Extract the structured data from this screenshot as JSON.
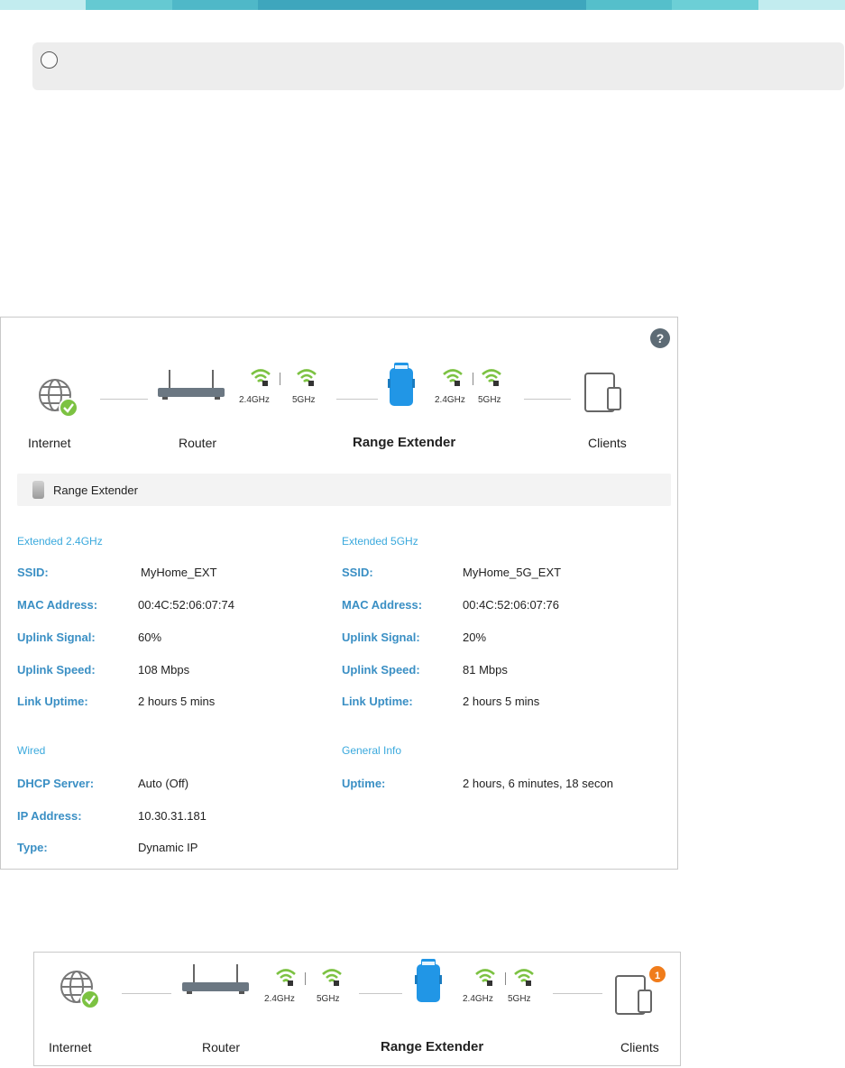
{
  "colors": {
    "accent_blue": "#3aa9dd",
    "label_blue": "#3a8fc4",
    "wifi_green": "#7cc242",
    "badge_orange": "#f07c1b",
    "strip": [
      "#c2ecef",
      "#65c9d2",
      "#4fb8c8",
      "#3ea6bd",
      "#55bfcb",
      "#6ccfd6",
      "#c2ecef"
    ]
  },
  "topology": {
    "internet_label": "Internet",
    "router_label": "Router",
    "extender_label": "Range Extender",
    "clients_label": "Clients",
    "router_bands": [
      "2.4GHz",
      "5GHz"
    ],
    "extender_bands": [
      "2.4GHz",
      "5GHz"
    ],
    "internet_icon": "globe-check-icon",
    "router_icon": "router-icon",
    "extender_icon": "range-extender-icon",
    "clients_icon": "tablet-phone-icon",
    "help_glyph": "?"
  },
  "section": {
    "title": "Range Extender"
  },
  "ext24": {
    "title": "Extended 2.4GHz",
    "rows": [
      {
        "key": "SSID:",
        "value": "MyHome_EXT"
      },
      {
        "key": "MAC Address:",
        "value": "00:4C:52:06:07:74"
      },
      {
        "key": "Uplink Signal:",
        "value": "60%"
      },
      {
        "key": "Uplink Speed:",
        "value": "108 Mbps"
      },
      {
        "key": "Link Uptime:",
        "value": "2 hours 5 mins"
      }
    ]
  },
  "ext5": {
    "title": "Extended 5GHz",
    "rows": [
      {
        "key": "SSID:",
        "value": "MyHome_5G_EXT"
      },
      {
        "key": "MAC Address:",
        "value": "00:4C:52:06:07:76"
      },
      {
        "key": "Uplink Signal:",
        "value": "20%"
      },
      {
        "key": "Uplink Speed:",
        "value": "81 Mbps"
      },
      {
        "key": "Link Uptime:",
        "value": "2 hours 5 mins"
      }
    ]
  },
  "wired": {
    "title": "Wired",
    "rows": [
      {
        "key": "DHCP Server:",
        "value": "Auto (Off)"
      },
      {
        "key": "IP Address:",
        "value": "10.30.31.181"
      },
      {
        "key": "Type:",
        "value": "Dynamic IP"
      }
    ]
  },
  "general": {
    "title": "General Info",
    "rows": [
      {
        "key": "Uptime:",
        "value": "2 hours, 6 minutes, 18 secon"
      }
    ]
  },
  "bottom": {
    "clients_badge": "1"
  }
}
